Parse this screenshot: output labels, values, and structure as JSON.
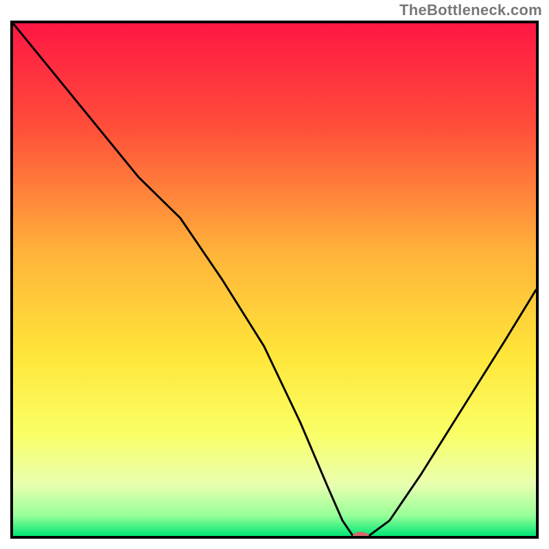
{
  "watermark": "TheBottleneck.com",
  "chart_data": {
    "type": "line",
    "title": "",
    "xlabel": "",
    "ylabel": "",
    "xlim": [
      0,
      100
    ],
    "ylim": [
      0,
      100
    ],
    "grid": false,
    "legend": false,
    "gradient_stops": [
      {
        "offset": 0,
        "color": "#ff1744"
      },
      {
        "offset": 20,
        "color": "#ff4d3a"
      },
      {
        "offset": 45,
        "color": "#ffb43a"
      },
      {
        "offset": 65,
        "color": "#ffe63a"
      },
      {
        "offset": 80,
        "color": "#faff66"
      },
      {
        "offset": 90,
        "color": "#e8ffb0"
      },
      {
        "offset": 96,
        "color": "#98ff98"
      },
      {
        "offset": 100,
        "color": "#00e676"
      }
    ],
    "series": [
      {
        "name": "bottleneck-curve",
        "x": [
          0,
          8,
          16,
          24,
          32,
          40,
          48,
          55,
          60,
          63,
          65,
          68,
          72,
          78,
          86,
          94,
          100
        ],
        "y": [
          100,
          90,
          80,
          70,
          62,
          50,
          37,
          22,
          10,
          3,
          0,
          0,
          3,
          12,
          25,
          38,
          48
        ]
      }
    ],
    "marker": {
      "name": "optimal-marker",
      "x": 66.5,
      "y": 0,
      "color": "#d46a6a",
      "rx": 12,
      "ry": 6
    },
    "frame_color": "#000000",
    "frame_width": 4
  }
}
